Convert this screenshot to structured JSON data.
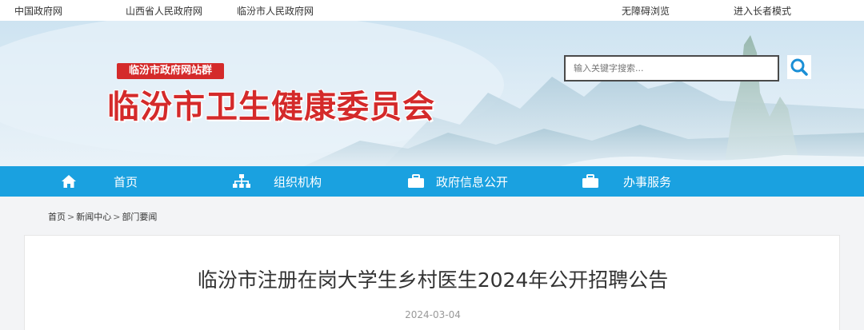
{
  "topbar": {
    "links": [
      "中国政府网",
      "山西省人民政府网",
      "临汾市人民政府网"
    ],
    "accessibility": "无障碍浏览",
    "elder_mode": "进入长者模式"
  },
  "header": {
    "site_group": "临汾市政府网站群",
    "title": "临汾市卫生健康委员会",
    "search": {
      "placeholder": "输入关键字搜索...",
      "value": ""
    }
  },
  "nav": {
    "items": [
      {
        "label": "首页",
        "icon": "home-icon"
      },
      {
        "label": "组织机构",
        "icon": "org-chart-icon"
      },
      {
        "label": "政府信息公开",
        "icon": "briefcase-icon"
      },
      {
        "label": "办事服务",
        "icon": "briefcase-icon"
      }
    ]
  },
  "breadcrumb": {
    "items": [
      "首页",
      "新闻中心",
      "部门要闻"
    ],
    "separator": ">"
  },
  "article": {
    "title": "临汾市注册在岗大学生乡村医生2024年公开招聘公告",
    "date": "2024-03-04"
  },
  "colors": {
    "brand_red": "#d42a2a",
    "nav_blue": "#1aa1e0",
    "search_blue": "#1a8fd6"
  }
}
